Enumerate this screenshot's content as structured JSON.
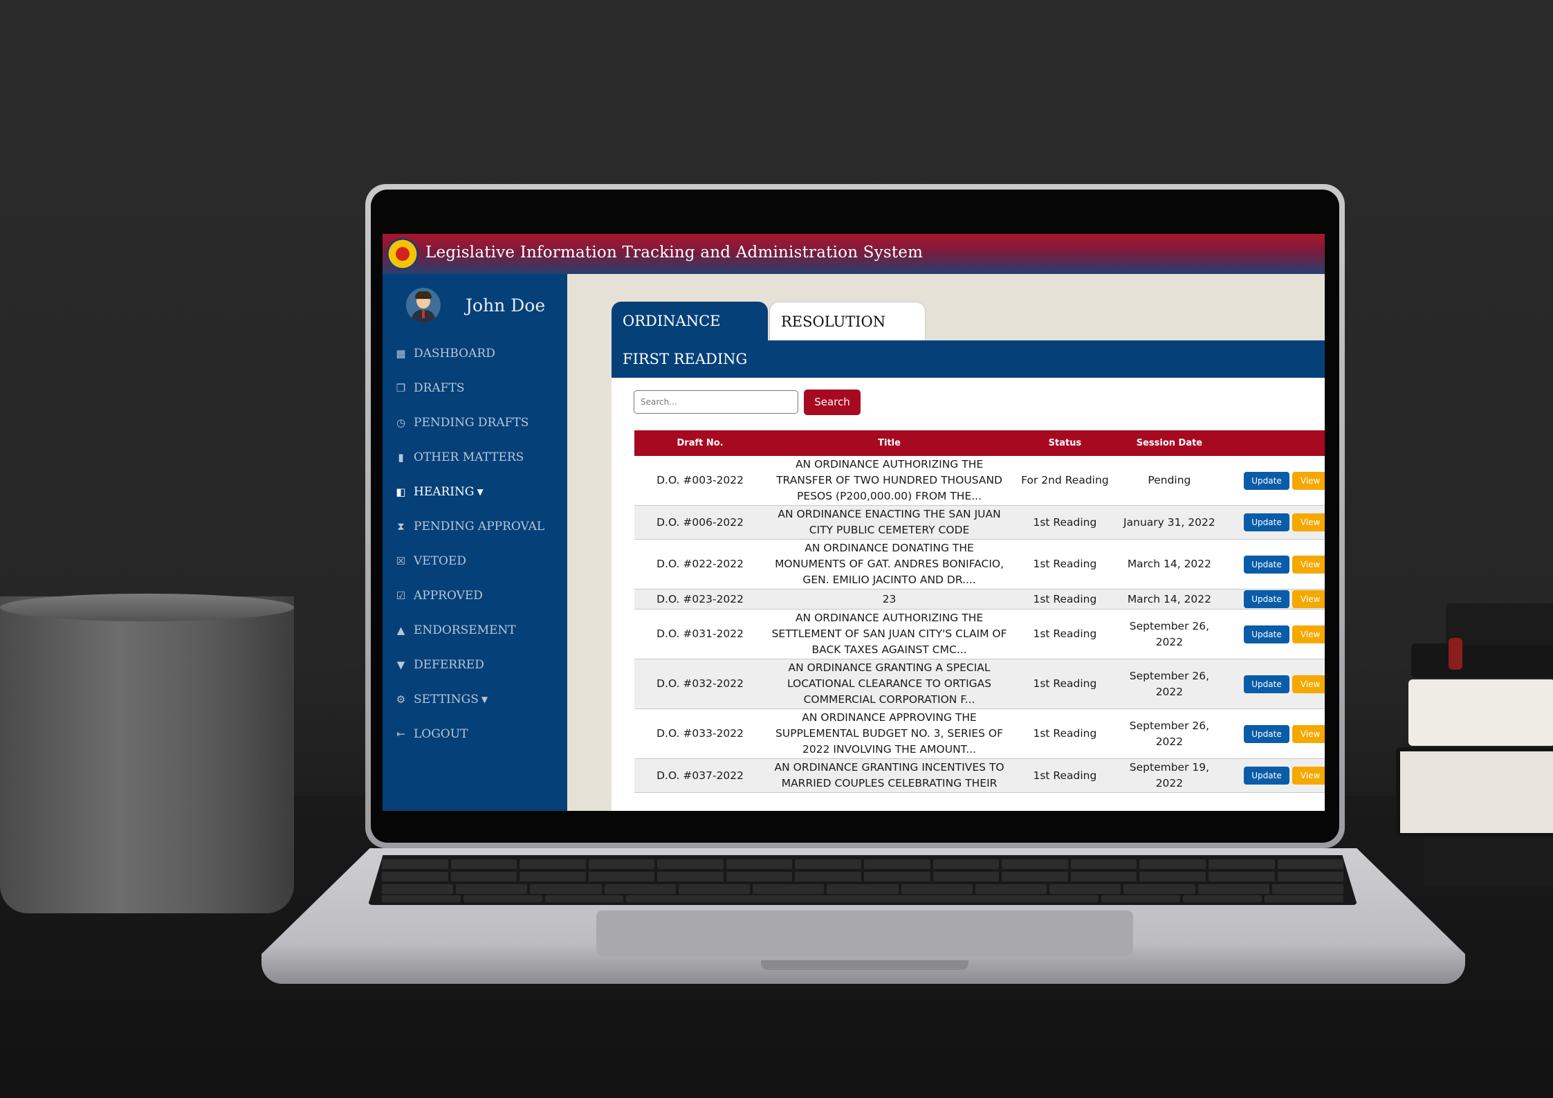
{
  "app": {
    "title": "Legislative Information Tracking and Administration System",
    "accent_colors": {
      "header_red": "#a8182d",
      "nav_blue": "#054079",
      "table_red": "#a70a20",
      "update_blue": "#0a5ca8",
      "view_orange": "#f5a800"
    }
  },
  "user": {
    "name": "John Doe",
    "avatar_icon": "user-avatar-icon"
  },
  "sidebar": {
    "items": [
      {
        "label": "DASHBOARD",
        "icon": "dashboard-icon"
      },
      {
        "label": "DRAFTS",
        "icon": "copy-icon"
      },
      {
        "label": "PENDING DRAFTS",
        "icon": "clock-icon"
      },
      {
        "label": "OTHER MATTERS",
        "icon": "bookmark-icon"
      },
      {
        "label": "HEARING",
        "icon": "book-icon"
      },
      {
        "label": "PENDING APPROVAL",
        "icon": "hourglass-icon"
      },
      {
        "label": "VETOED",
        "icon": "x-square-icon"
      },
      {
        "label": "APPROVED",
        "icon": "check-square-icon"
      },
      {
        "label": "ENDORSEMENT",
        "icon": "thumbs-up-icon"
      },
      {
        "label": "DEFERRED",
        "icon": "thumbs-down-icon"
      },
      {
        "label": "SETTINGS",
        "icon": "gear-icon"
      },
      {
        "label": "LOGOUT",
        "icon": "logout-icon"
      }
    ]
  },
  "tabs": [
    {
      "label": "ORDINANCE",
      "active": true
    },
    {
      "label": "RESOLUTION",
      "active": false
    }
  ],
  "panel": {
    "heading": "FIRST READING"
  },
  "search": {
    "placeholder": "Search...",
    "button_label": "Search"
  },
  "table": {
    "headers": [
      "Draft No.",
      "Title",
      "Status",
      "Session Date",
      ""
    ],
    "rows": [
      {
        "draft_no": "D.O. #003-2022",
        "title": [
          "AN ORDINANCE AUTHORIZING THE",
          "TRANSFER OF TWO HUNDRED THOUSAND",
          "PESOS (P200,000.00) FROM THE..."
        ],
        "status": "For 2nd Reading",
        "date": [
          "Pending"
        ]
      },
      {
        "draft_no": "D.O. #006-2022",
        "title": [
          "AN ORDINANCE ENACTING THE SAN JUAN",
          "CITY PUBLIC CEMETERY CODE"
        ],
        "status": "1st Reading",
        "date": [
          "January 31, 2022"
        ]
      },
      {
        "draft_no": "D.O. #022-2022",
        "title": [
          "AN ORDINANCE DONATING THE",
          "MONUMENTS OF GAT. ANDRES BONIFACIO,",
          "GEN. EMILIO JACINTO AND DR...."
        ],
        "status": "1st Reading",
        "date": [
          "March 14, 2022"
        ]
      },
      {
        "draft_no": "D.O. #023-2022",
        "title": [
          "23"
        ],
        "status": "1st Reading",
        "date": [
          "March 14, 2022"
        ]
      },
      {
        "draft_no": "D.O. #031-2022",
        "title": [
          "AN ORDINANCE AUTHORIZING THE",
          "SETTLEMENT OF SAN JUAN CITY'S CLAIM OF",
          "BACK TAXES AGAINST CMC..."
        ],
        "status": "1st Reading",
        "date": [
          "September 26,",
          "2022"
        ]
      },
      {
        "draft_no": "D.O. #032-2022",
        "title": [
          "AN ORDINANCE GRANTING A SPECIAL",
          "LOCATIONAL CLEARANCE TO ORTIGAS",
          "COMMERCIAL CORPORATION F..."
        ],
        "status": "1st Reading",
        "date": [
          "September 26,",
          "2022"
        ]
      },
      {
        "draft_no": "D.O. #033-2022",
        "title": [
          "AN ORDINANCE APPROVING THE",
          "SUPPLEMENTAL BUDGET NO. 3, SERIES OF",
          "2022 INVOLVING THE AMOUNT..."
        ],
        "status": "1st Reading",
        "date": [
          "September 26,",
          "2022"
        ]
      },
      {
        "draft_no": "D.O. #037-2022",
        "title": [
          "AN ORDINANCE GRANTING INCENTIVES TO",
          "MARRIED COUPLES CELEBRATING THEIR",
          ""
        ],
        "status": "1st Reading",
        "date": [
          "September 19,",
          "2022"
        ]
      }
    ],
    "actions": {
      "update_label": "Update",
      "view_label": "View"
    }
  }
}
